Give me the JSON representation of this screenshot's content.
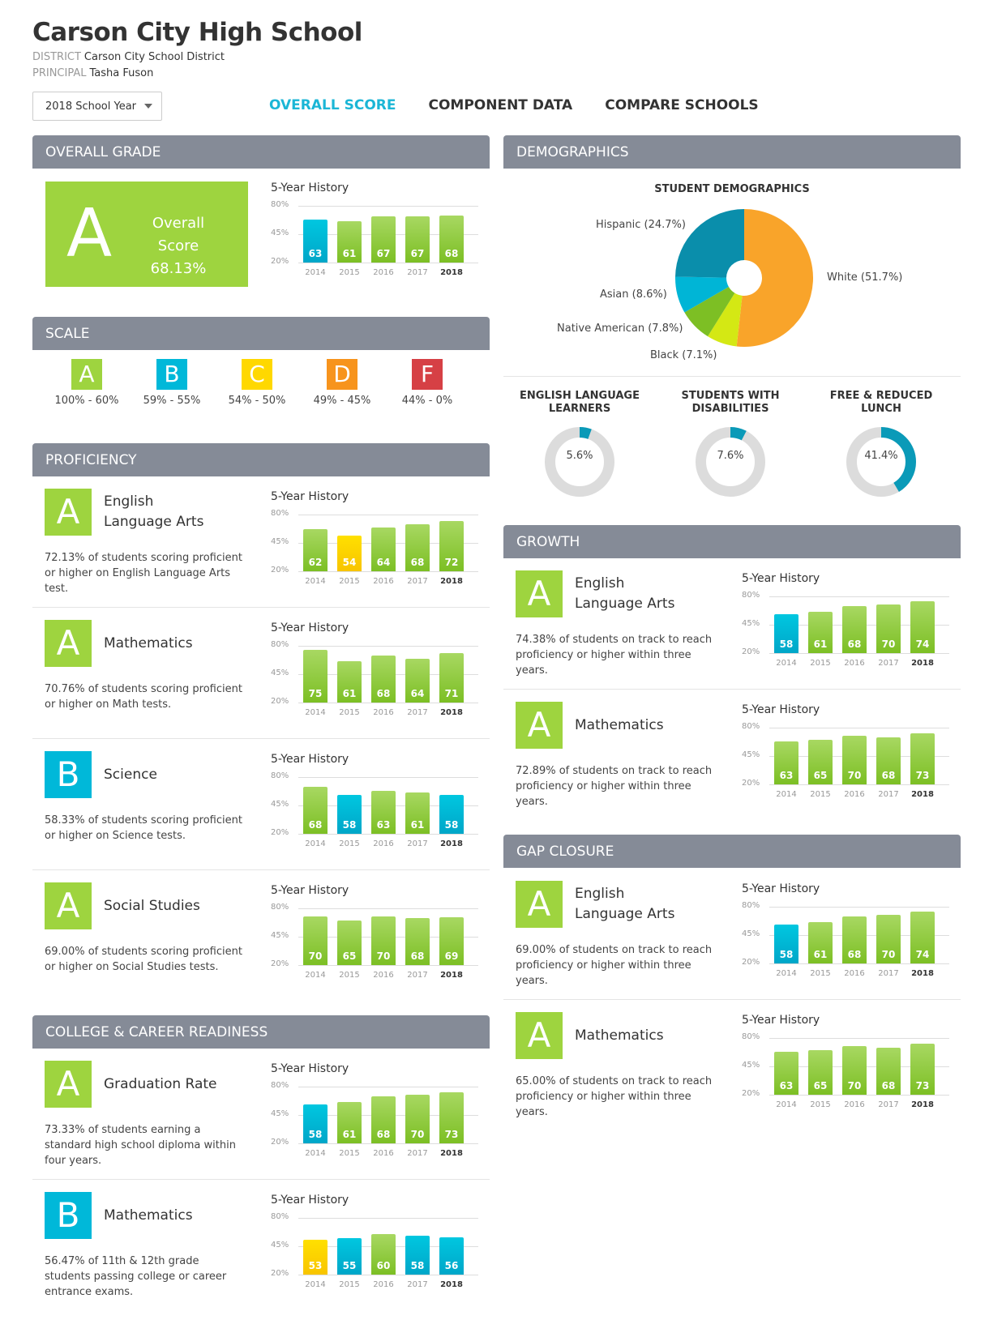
{
  "header": {
    "title": "Carson City High School",
    "district_label": "DISTRICT",
    "district": "Carson City School District",
    "principal_label": "PRINCIPAL",
    "principal": "Tasha Fuson",
    "year_select": "2018 School Year"
  },
  "tabs": [
    {
      "label": "OVERALL SCORE",
      "active": true
    },
    {
      "label": "COMPONENT DATA",
      "active": false
    },
    {
      "label": "COMPARE SCHOOLS",
      "active": false
    }
  ],
  "colors": {
    "A": "#9ed43f",
    "B": "#00b8d9",
    "C": "#ffd800",
    "D": "#f7941d",
    "F": "#d64045",
    "accent": "#1bb6d6",
    "panel_header": "#858b97"
  },
  "chart_common": {
    "title": "5-Year History",
    "y_ticks": [
      "80%",
      "45%",
      "20%"
    ],
    "years": [
      "2014",
      "2015",
      "2016",
      "2017",
      "2018"
    ],
    "current_year": "2018"
  },
  "overall": {
    "header": "OVERALL GRADE",
    "grade": "A",
    "score_label": "Overall Score",
    "score": "68.13%",
    "history": {
      "values": [
        63,
        61,
        67,
        67,
        68
      ],
      "grades": [
        "B",
        "A",
        "A",
        "A",
        "A"
      ]
    }
  },
  "scale": {
    "header": "SCALE",
    "items": [
      {
        "grade": "A",
        "range": "100% - 60%"
      },
      {
        "grade": "B",
        "range": "59% - 55%"
      },
      {
        "grade": "C",
        "range": "54% - 50%"
      },
      {
        "grade": "D",
        "range": "49% - 45%"
      },
      {
        "grade": "F",
        "range": "44% - 0%"
      }
    ]
  },
  "proficiency": {
    "header": "PROFICIENCY",
    "rows": [
      {
        "grade": "A",
        "subject": "English Language Arts",
        "subject_lines": [
          "English",
          "Language Arts"
        ],
        "desc": "72.13% of students scoring proficient or higher on English Language Arts test.",
        "values": [
          62,
          54,
          64,
          68,
          72
        ],
        "grades": [
          "A",
          "C",
          "A",
          "A",
          "A"
        ]
      },
      {
        "grade": "A",
        "subject": "Mathematics",
        "subject_lines": [
          "Mathematics"
        ],
        "desc": "70.76% of students scoring proficient or higher on Math tests.",
        "values": [
          75,
          61,
          68,
          64,
          71
        ],
        "grades": [
          "A",
          "A",
          "A",
          "A",
          "A"
        ]
      },
      {
        "grade": "B",
        "subject": "Science",
        "subject_lines": [
          "Science"
        ],
        "desc": "58.33% of students scoring proficient or higher on Science tests.",
        "values": [
          68,
          58,
          63,
          61,
          58
        ],
        "grades": [
          "A",
          "B",
          "A",
          "A",
          "B"
        ]
      },
      {
        "grade": "A",
        "subject": "Social Studies",
        "subject_lines": [
          "Social Studies"
        ],
        "desc": "69.00% of students scoring proficient or higher on Social Studies tests.",
        "values": [
          70,
          65,
          70,
          68,
          69
        ],
        "grades": [
          "A",
          "A",
          "A",
          "A",
          "A"
        ]
      }
    ]
  },
  "ccr": {
    "header": "COLLEGE & CAREER READINESS",
    "rows": [
      {
        "grade": "A",
        "subject": "Graduation Rate",
        "subject_lines": [
          "Graduation Rate"
        ],
        "desc": "73.33% of students earning a standard high school diploma within four years.",
        "values": [
          58,
          61,
          68,
          70,
          73
        ],
        "grades": [
          "B",
          "A",
          "A",
          "A",
          "A"
        ]
      },
      {
        "grade": "B",
        "subject": "Mathematics",
        "subject_lines": [
          "Mathematics"
        ],
        "desc": "56.47% of 11th & 12th grade students passing college or career entrance exams.",
        "values": [
          53,
          55,
          60,
          58,
          56
        ],
        "grades": [
          "C",
          "B",
          "A",
          "B",
          "B"
        ]
      }
    ]
  },
  "demographics": {
    "header": "DEMOGRAPHICS",
    "chart_title": "STUDENT DEMOGRAPHICS",
    "slices": [
      {
        "label": "White (51.7%)",
        "name": "White",
        "value": 51.7,
        "color": "#f9a42a"
      },
      {
        "label": "Black (7.1%)",
        "name": "Black",
        "value": 7.1,
        "color": "#d4e814"
      },
      {
        "label": "Native American (7.8%)",
        "name": "Native American",
        "value": 7.8,
        "color": "#7dbf24"
      },
      {
        "label": "Asian (8.6%)",
        "name": "Asian",
        "value": 8.6,
        "color": "#00b5d6"
      },
      {
        "label": "Hispanic (24.7%)",
        "name": "Hispanic",
        "value": 24.7,
        "color": "#0a8eab"
      }
    ],
    "rings": [
      {
        "title_lines": [
          "ENGLISH LANGUAGE",
          "LEARNERS"
        ],
        "value": 5.6,
        "label": "5.6%"
      },
      {
        "title_lines": [
          "STUDENTS WITH",
          "DISABILITIES"
        ],
        "value": 7.6,
        "label": "7.6%"
      },
      {
        "title_lines": [
          "FREE & REDUCED",
          "LUNCH"
        ],
        "value": 41.4,
        "label": "41.4%"
      }
    ]
  },
  "growth": {
    "header": "GROWTH",
    "rows": [
      {
        "grade": "A",
        "subject": "English Language Arts",
        "subject_lines": [
          "English",
          "Language Arts"
        ],
        "desc": "74.38% of students on track to reach proficiency or higher within three years.",
        "values": [
          58,
          61,
          68,
          70,
          74
        ],
        "grades": [
          "B",
          "A",
          "A",
          "A",
          "A"
        ]
      },
      {
        "grade": "A",
        "subject": "Mathematics",
        "subject_lines": [
          "Mathematics"
        ],
        "desc": "72.89% of students on track to reach proficiency or higher within three years.",
        "values": [
          63,
          65,
          70,
          68,
          73
        ],
        "grades": [
          "A",
          "A",
          "A",
          "A",
          "A"
        ]
      }
    ]
  },
  "gap_closure": {
    "header": "GAP CLOSURE",
    "rows": [
      {
        "grade": "A",
        "subject": "English Language Arts",
        "subject_lines": [
          "English",
          "Language Arts"
        ],
        "desc": "69.00% of students on track to reach proficiency or higher within three years.",
        "values": [
          58,
          61,
          68,
          70,
          74
        ],
        "grades": [
          "B",
          "A",
          "A",
          "A",
          "A"
        ]
      },
      {
        "grade": "A",
        "subject": "Mathematics",
        "subject_lines": [
          "Mathematics"
        ],
        "desc": "65.00% of students on track to reach proficiency or higher within three years.",
        "values": [
          63,
          65,
          70,
          68,
          73
        ],
        "grades": [
          "A",
          "A",
          "A",
          "A",
          "A"
        ]
      }
    ]
  },
  "chart_data": [
    {
      "type": "bar",
      "title": "5-Year History (Overall)",
      "categories": [
        "2014",
        "2015",
        "2016",
        "2017",
        "2018"
      ],
      "values": [
        63,
        61,
        67,
        67,
        68
      ],
      "ylim": [
        20,
        80
      ]
    },
    {
      "type": "bar",
      "title": "5-Year History (Proficiency ELA)",
      "categories": [
        "2014",
        "2015",
        "2016",
        "2017",
        "2018"
      ],
      "values": [
        62,
        54,
        64,
        68,
        72
      ],
      "ylim": [
        20,
        80
      ]
    },
    {
      "type": "bar",
      "title": "5-Year History (Proficiency Math)",
      "categories": [
        "2014",
        "2015",
        "2016",
        "2017",
        "2018"
      ],
      "values": [
        75,
        61,
        68,
        64,
        71
      ],
      "ylim": [
        20,
        80
      ]
    },
    {
      "type": "bar",
      "title": "5-Year History (Science)",
      "categories": [
        "2014",
        "2015",
        "2016",
        "2017",
        "2018"
      ],
      "values": [
        68,
        58,
        63,
        61,
        58
      ],
      "ylim": [
        20,
        80
      ]
    },
    {
      "type": "bar",
      "title": "5-Year History (Social Studies)",
      "categories": [
        "2014",
        "2015",
        "2016",
        "2017",
        "2018"
      ],
      "values": [
        70,
        65,
        70,
        68,
        69
      ],
      "ylim": [
        20,
        80
      ]
    },
    {
      "type": "bar",
      "title": "5-Year History (Graduation Rate)",
      "categories": [
        "2014",
        "2015",
        "2016",
        "2017",
        "2018"
      ],
      "values": [
        58,
        61,
        68,
        70,
        73
      ],
      "ylim": [
        20,
        80
      ]
    },
    {
      "type": "bar",
      "title": "5-Year History (CCR Math)",
      "categories": [
        "2014",
        "2015",
        "2016",
        "2017",
        "2018"
      ],
      "values": [
        53,
        55,
        60,
        58,
        56
      ],
      "ylim": [
        20,
        80
      ]
    },
    {
      "type": "bar",
      "title": "5-Year History (Growth ELA)",
      "categories": [
        "2014",
        "2015",
        "2016",
        "2017",
        "2018"
      ],
      "values": [
        58,
        61,
        68,
        70,
        74
      ],
      "ylim": [
        20,
        80
      ]
    },
    {
      "type": "bar",
      "title": "5-Year History (Growth Math)",
      "categories": [
        "2014",
        "2015",
        "2016",
        "2017",
        "2018"
      ],
      "values": [
        63,
        65,
        70,
        68,
        73
      ],
      "ylim": [
        20,
        80
      ]
    },
    {
      "type": "bar",
      "title": "5-Year History (Gap ELA)",
      "categories": [
        "2014",
        "2015",
        "2016",
        "2017",
        "2018"
      ],
      "values": [
        58,
        61,
        68,
        70,
        74
      ],
      "ylim": [
        20,
        80
      ]
    },
    {
      "type": "bar",
      "title": "5-Year History (Gap Math)",
      "categories": [
        "2014",
        "2015",
        "2016",
        "2017",
        "2018"
      ],
      "values": [
        63,
        65,
        70,
        68,
        73
      ],
      "ylim": [
        20,
        80
      ]
    },
    {
      "type": "pie",
      "title": "STUDENT DEMOGRAPHICS",
      "categories": [
        "White",
        "Black",
        "Native American",
        "Asian",
        "Hispanic"
      ],
      "values": [
        51.7,
        7.1,
        7.8,
        8.6,
        24.7
      ]
    },
    {
      "type": "pie",
      "title": "ENGLISH LANGUAGE LEARNERS",
      "values": [
        5.6
      ]
    },
    {
      "type": "pie",
      "title": "STUDENTS WITH DISABILITIES",
      "values": [
        7.6
      ]
    },
    {
      "type": "pie",
      "title": "FREE & REDUCED LUNCH",
      "values": [
        41.4
      ]
    }
  ]
}
